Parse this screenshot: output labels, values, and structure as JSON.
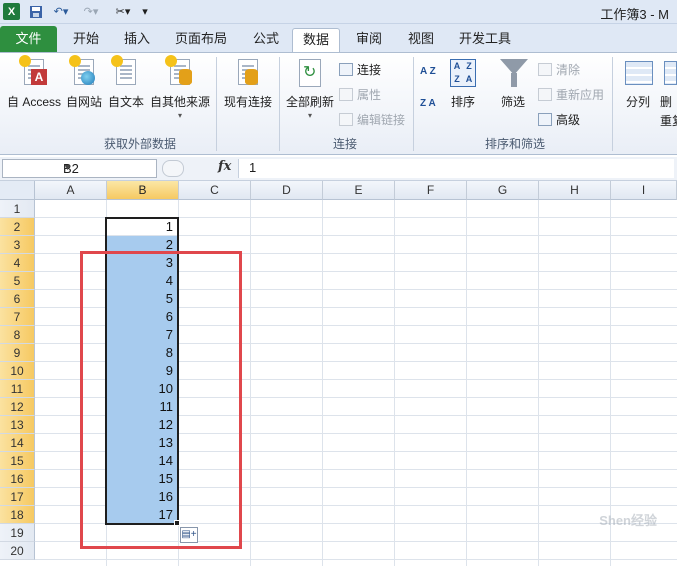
{
  "titlebar": {
    "app_icon": "X",
    "window_title": "工作簿3 - M",
    "icons": [
      "excel-logo-icon",
      "save-icon",
      "undo-icon",
      "redo-icon",
      "tools-icon"
    ]
  },
  "tabs": {
    "file": "文件",
    "items": [
      "开始",
      "插入",
      "页面布局",
      "公式",
      "数据",
      "审阅",
      "视图",
      "开发工具"
    ],
    "active": "数据"
  },
  "ribbon": {
    "get_external": {
      "label": "获取外部数据",
      "from_access": "自 Access",
      "from_web": "自网站",
      "from_text": "自文本",
      "from_other": "自其他来源",
      "existing": "现有连接"
    },
    "connections": {
      "label": "连接",
      "refresh_all": "全部刷新",
      "connections": "连接",
      "properties": "属性",
      "edit_links": "编辑链接"
    },
    "sort_filter": {
      "label": "排序和筛选",
      "sort": "排序",
      "filter": "筛选",
      "clear": "清除",
      "reapply": "重新应用",
      "advanced": "高级",
      "az": "A Z",
      "za": "Z A",
      "grid_letters": [
        "A",
        "Z",
        "Z",
        "A"
      ]
    },
    "data_tools": {
      "text_to_columns": "分列",
      "remove_partial": "删",
      "dup_partial": "重复"
    }
  },
  "formula_bar": {
    "name_box": "B2",
    "fx": "fx",
    "formula": "1"
  },
  "grid": {
    "columns": [
      "A",
      "B",
      "C",
      "D",
      "E",
      "F",
      "G",
      "H",
      "I"
    ],
    "selected_column": "B",
    "rows": [
      "1",
      "2",
      "3",
      "4",
      "5",
      "6",
      "7",
      "8",
      "9",
      "10",
      "11",
      "12",
      "13",
      "14",
      "15",
      "16",
      "17",
      "18",
      "19",
      "20"
    ],
    "selected_rows_range": "2-18",
    "column_b_values": [
      "1",
      "2",
      "3",
      "4",
      "5",
      "6",
      "7",
      "8",
      "9",
      "10",
      "11",
      "12",
      "13",
      "14",
      "15",
      "16",
      "17"
    ],
    "selection_range": "B2:B18"
  },
  "colors": {
    "file_tab": "#2e8f3f",
    "selection_fill": "#a7cbee",
    "annotation_border": "#e0474c",
    "header_highlight": "#f6c962"
  },
  "watermark": "Shen经验"
}
